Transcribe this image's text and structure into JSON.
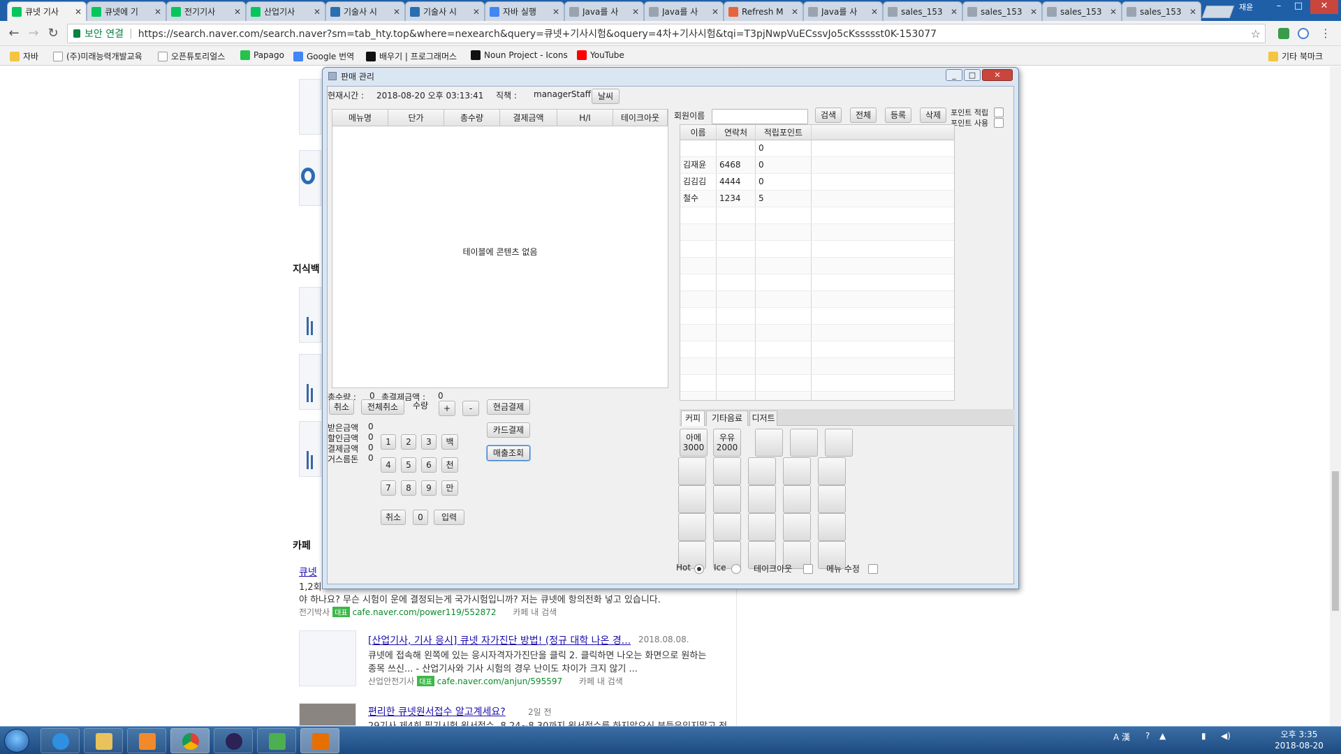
{
  "browser": {
    "tabs": [
      {
        "label": "큐넷 기사",
        "icon": "naver-icon",
        "color": "#03c75a",
        "active": true
      },
      {
        "label": "큐넷에 기",
        "icon": "cafe-icon",
        "color": "#03c75a"
      },
      {
        "label": "전기기사",
        "icon": "cafe-icon",
        "color": "#03c75a"
      },
      {
        "label": "산업기사",
        "icon": "cafe-icon",
        "color": "#03c75a"
      },
      {
        "label": "기술사 시",
        "icon": "globe-icon",
        "color": "#2a6fb0"
      },
      {
        "label": "기술사 시",
        "icon": "globe-icon",
        "color": "#2a6fb0"
      },
      {
        "label": "자바 실행",
        "icon": "google-icon",
        "color": "#4285f4"
      },
      {
        "label": "Java를 사",
        "icon": "page-icon",
        "color": "#9aa4b0"
      },
      {
        "label": "Java를 사",
        "icon": "page-icon",
        "color": "#9aa4b0"
      },
      {
        "label": "Refresh M",
        "icon": "refresh-icon",
        "color": "#e8643a"
      },
      {
        "label": "Java를 사",
        "icon": "page-icon",
        "color": "#9aa4b0"
      },
      {
        "label": "sales_153",
        "icon": "page-icon",
        "color": "#9aa4b0"
      },
      {
        "label": "sales_153",
        "icon": "page-icon",
        "color": "#9aa4b0"
      },
      {
        "label": "sales_153",
        "icon": "page-icon",
        "color": "#9aa4b0"
      },
      {
        "label": "sales_153",
        "icon": "page-icon",
        "color": "#9aa4b0"
      }
    ],
    "user": "재윤",
    "secure_label": "보안 연결",
    "url": "https://search.naver.com/search.naver?sm=tab_hty.top&where=nexearch&query=큐넷+기사시험&oquery=4차+기사시험&tqi=T3pjNwpVuECssvJo5cKssssst0K-153077",
    "bookmarks": [
      {
        "label": "자바",
        "icon": "folder-icon",
        "color": "#f4c542"
      },
      {
        "label": "(주)미래능력개발교육",
        "icon": "page-icon",
        "color": "#ffffff"
      },
      {
        "label": "오픈튜토리얼스",
        "icon": "page-icon",
        "color": "#ffffff"
      },
      {
        "label": "Papago",
        "icon": "papago-icon",
        "color": "#27c24c"
      },
      {
        "label": "Google 번역",
        "icon": "translate-icon",
        "color": "#4285f4"
      },
      {
        "label": "배우기 | 프로그래머스",
        "icon": "programmers-icon",
        "color": "#111111"
      },
      {
        "label": "Noun Project - Icons",
        "icon": "noun-icon",
        "color": "#111111"
      },
      {
        "label": "YouTube",
        "icon": "youtube-icon",
        "color": "#ff0000"
      }
    ],
    "other_bookmarks": "기타 북마크"
  },
  "background_page": {
    "section_knowledge": "지식백",
    "section_cafe": "카페",
    "result1": {
      "title": "큐넷",
      "line1": "1,2회",
      "line2": "야 하나요? 무슨 시험이 운에 결정되는게 국가시험입니까? 저는 큐넷에 항의전화 넣고 있습니다.",
      "author": "전기박사",
      "badge": "대표",
      "url": "cafe.naver.com/power119/552872",
      "search_in": "카페 내 검색"
    },
    "result2": {
      "title": "[산업기사, 기사 응시] 큐넷 자가진단 방법! (정규 대학 나온 경...",
      "date": "2018.08.08.",
      "line1": "큐넷에 접속해 왼쪽에 있는 응시자격자가진단을 클릭 2. 클릭하면 나오는 화면으로 원하는",
      "line2": "종목 쓰신... - 산업기사와 기사 시험의 경우 난이도 차이가 크지 않기 ...",
      "author": "산업안전기사",
      "badge": "대표",
      "url": "cafe.naver.com/anjun/595597",
      "search_in": "카페 내 검색"
    },
    "result3": {
      "title": "편리한 큐넷원서접수 알고계세요?",
      "date": "2일 전",
      "line1": "29기사 제4회 필기시험 원서접수 -8.24~8.30까지 원서접수를 하지않으신 분들은잊지말고 전"
    }
  },
  "app": {
    "window_title": "판매 관리",
    "current_time_label": "현재시간 :",
    "current_time": "2018-08-20 오후 03:13:41",
    "role_label": "직책 :",
    "role": "managerStaff",
    "weather_button": "날씨",
    "order_columns": [
      "메뉴명",
      "단가",
      "총수량",
      "결제금액",
      "H/I",
      "테이크아웃"
    ],
    "order_empty": "테이블에 콘텐츠 없음",
    "total_qty_label": "총수량 :",
    "total_qty": "0",
    "total_pay_label": "총결제금액 :",
    "total_pay": "0",
    "cancel_button": "취소",
    "cancel_all_button": "전체취소",
    "qty_label": "수량",
    "plus_button": "+",
    "minus_button": "-",
    "cash_button": "현금결제",
    "card_button": "카드결제",
    "sales_button": "매출조회",
    "received_label": "받은금액",
    "received": "0",
    "discount_label": "할인금액",
    "discount": "0",
    "paid_label": "결제금액",
    "paid": "0",
    "change_label": "거스름돈",
    "change": "0",
    "keypad": [
      "1",
      "2",
      "3",
      "백",
      "4",
      "5",
      "6",
      "천",
      "7",
      "8",
      "9",
      "만"
    ],
    "keypad_cancel": "취소",
    "keypad_zero": "0",
    "keypad_enter": "입력",
    "member_name_label": "회원이름",
    "member_name_value": "",
    "search_button": "검색",
    "all_button": "전체",
    "register_button": "등록",
    "delete_button": "삭제",
    "point_save_label": "포인트 적립",
    "point_use_label": "포인트 사용",
    "member_columns": [
      "이름",
      "연락처",
      "적립포인트"
    ],
    "members": [
      {
        "name": "",
        "phone": "",
        "points": "0"
      },
      {
        "name": "김재윤",
        "phone": "6468",
        "points": "0"
      },
      {
        "name": "김김김",
        "phone": "4444",
        "points": "0"
      },
      {
        "name": "철수",
        "phone": "1234",
        "points": "5"
      }
    ],
    "category_tabs": [
      "커피",
      "기타음료",
      "디저트"
    ],
    "menu_items": [
      {
        "name": "아메",
        "price": "3000"
      },
      {
        "name": "우유",
        "price": "2000"
      }
    ],
    "hot_label": "Hot",
    "ice_label": "Ice",
    "takeout_label": "테이크아웃",
    "edit_menu_label": "메뉴 수정"
  },
  "taskbar": {
    "tray_lang": "A 漢",
    "clock_time": "오후 3:35",
    "clock_date": "2018-08-20"
  },
  "colors": {
    "taskbar": "#1c4a80",
    "window_frame": "#dbe6f3",
    "close_button": "#c9463d",
    "link": "#1a0dab"
  }
}
